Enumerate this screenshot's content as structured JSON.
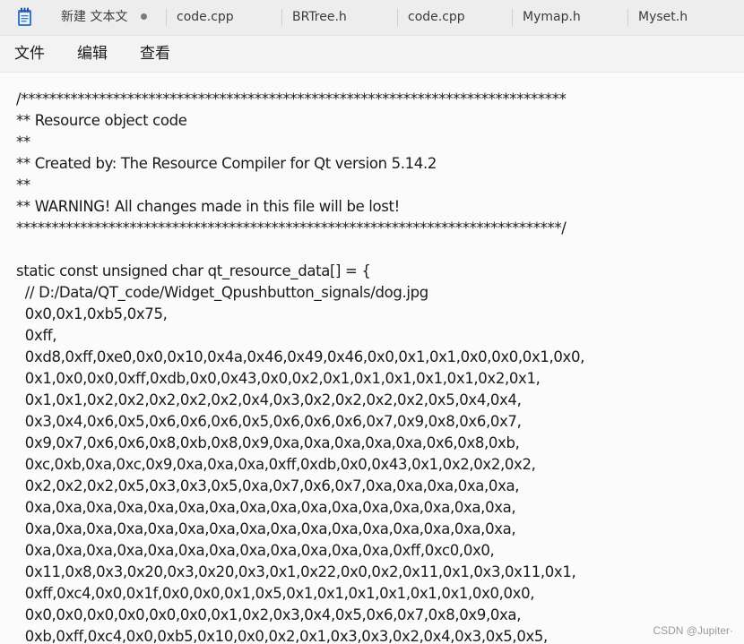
{
  "tabs": [
    {
      "label": "新建 文本文",
      "modified": true
    },
    {
      "label": "code.cpp"
    },
    {
      "label": "BRTree.h"
    },
    {
      "label": "code.cpp"
    },
    {
      "label": "Mymap.h"
    },
    {
      "label": "Myset.h"
    }
  ],
  "menu": {
    "file": "文件",
    "edit": "编辑",
    "view": "查看"
  },
  "editor": {
    "lines": [
      "/*****************************************************************************",
      "** Resource object code",
      "**",
      "** Created by: The Resource Compiler for Qt version 5.14.2",
      "**",
      "** WARNING! All changes made in this file will be lost!",
      "*****************************************************************************/",
      "",
      "static const unsigned char qt_resource_data[] = {",
      "  // D:/Data/QT_code/Widget_Qpushbutton_signals/dog.jpg",
      "  0x0,0x1,0xb5,0x75,",
      "  0xff,",
      "  0xd8,0xff,0xe0,0x0,0x10,0x4a,0x46,0x49,0x46,0x0,0x1,0x1,0x0,0x0,0x1,0x0,",
      "  0x1,0x0,0x0,0xff,0xdb,0x0,0x43,0x0,0x2,0x1,0x1,0x1,0x1,0x1,0x2,0x1,",
      "  0x1,0x1,0x2,0x2,0x2,0x2,0x2,0x4,0x3,0x2,0x2,0x2,0x2,0x5,0x4,0x4,",
      "  0x3,0x4,0x6,0x5,0x6,0x6,0x6,0x5,0x6,0x6,0x6,0x7,0x9,0x8,0x6,0x7,",
      "  0x9,0x7,0x6,0x6,0x8,0xb,0x8,0x9,0xa,0xa,0xa,0xa,0xa,0x6,0x8,0xb,",
      "  0xc,0xb,0xa,0xc,0x9,0xa,0xa,0xa,0xff,0xdb,0x0,0x43,0x1,0x2,0x2,0x2,",
      "  0x2,0x2,0x2,0x5,0x3,0x3,0x5,0xa,0x7,0x6,0x7,0xa,0xa,0xa,0xa,0xa,",
      "  0xa,0xa,0xa,0xa,0xa,0xa,0xa,0xa,0xa,0xa,0xa,0xa,0xa,0xa,0xa,0xa,",
      "  0xa,0xa,0xa,0xa,0xa,0xa,0xa,0xa,0xa,0xa,0xa,0xa,0xa,0xa,0xa,0xa,",
      "  0xa,0xa,0xa,0xa,0xa,0xa,0xa,0xa,0xa,0xa,0xa,0xa,0xff,0xc0,0x0,",
      "  0x11,0x8,0x3,0x20,0x3,0x20,0x3,0x1,0x22,0x0,0x2,0x11,0x1,0x3,0x11,0x1,",
      "  0xff,0xc4,0x0,0x1f,0x0,0x0,0x1,0x5,0x1,0x1,0x1,0x1,0x1,0x1,0x0,0x0,",
      "  0x0,0x0,0x0,0x0,0x0,0x0,0x1,0x2,0x3,0x4,0x5,0x6,0x7,0x8,0x9,0xa,",
      "  0xb,0xff,0xc4,0x0,0xb5,0x10,0x0,0x2,0x1,0x3,0x3,0x2,0x4,0x3,0x5,0x5,"
    ]
  },
  "watermark": "CSDN @Jupiter·"
}
